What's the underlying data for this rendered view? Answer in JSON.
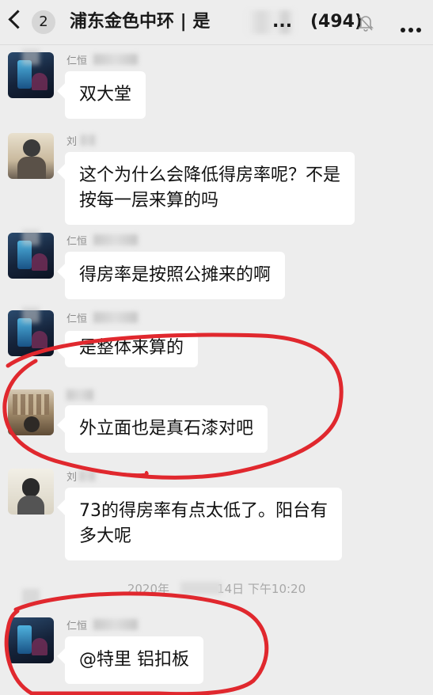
{
  "header": {
    "unread_count": "2",
    "title": "浦东金色中环 | 是",
    "title_trailing": "...",
    "member_count": "(494)",
    "back_icon": "chevron-left-icon",
    "mute_icon": "bell-off-icon",
    "more_icon": "more-dots-icon"
  },
  "messages": [
    {
      "sender": "仁恒",
      "text_lines": [
        "双大堂"
      ]
    },
    {
      "sender": "刘",
      "text_lines": [
        "这个为什么会降低得房率呢？不是",
        "按每一层来算的吗"
      ]
    },
    {
      "sender": "仁恒",
      "text_lines": [
        "得房率是按照公摊来的啊"
      ]
    },
    {
      "sender": "仁恒",
      "text_lines": [
        "是整体来算的"
      ]
    },
    {
      "sender": "",
      "text_lines": [
        "外立面也是真石漆对吧"
      ]
    },
    {
      "sender": "刘",
      "text_lines": [
        "73的得房率有点太低了。阳台有",
        "多大呢"
      ]
    },
    {
      "sender": "仁恒",
      "text_lines": [
        "@特里 铝扣板"
      ]
    }
  ],
  "timestamp": {
    "year": "2020年",
    "day": "14日",
    "time": "下午10:20"
  },
  "colors": {
    "background": "#ededed",
    "bubble": "#ffffff",
    "annotation": "#e0282e"
  }
}
